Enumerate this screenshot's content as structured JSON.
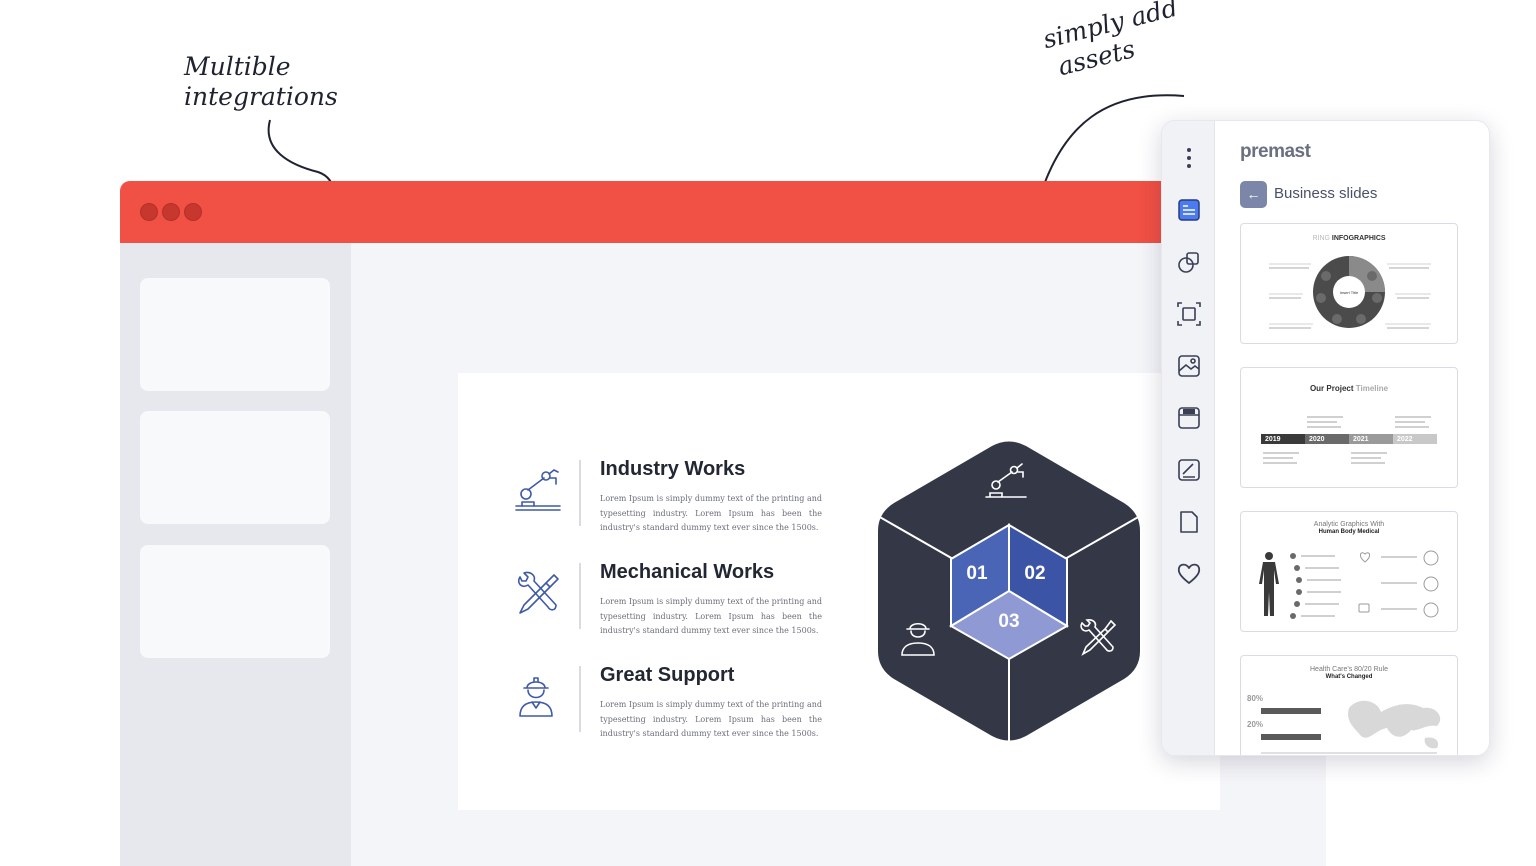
{
  "annotations": {
    "left_line1": "Multible",
    "left_line2": "integrations",
    "right_line1": "simply add",
    "right_line2": "assets"
  },
  "slide": {
    "features": [
      {
        "title": "Industry Works",
        "text": "Lorem Ipsum is simply dummy text of the printing and typesetting industry.  Lorem Ipsum has been the industry's standard dummy text ever since the 1500s.",
        "icon": "robot-arm-icon"
      },
      {
        "title": "Mechanical Works",
        "text": "Lorem Ipsum is simply dummy text of the printing and typesetting industry.  Lorem Ipsum has been the industry's standard dummy text ever since the 1500s.",
        "icon": "wrench-screwdriver-icon"
      },
      {
        "title": "Great Support",
        "text": "Lorem Ipsum is simply dummy text of the printing and typesetting industry.  Lorem Ipsum has been the industry's standard dummy text ever since the 1500s.",
        "icon": "worker-icon"
      }
    ],
    "cube_labels": [
      "01",
      "02",
      "03"
    ]
  },
  "panel": {
    "brand": "premast",
    "back_label": "←",
    "title": "Business slides",
    "rail_icons": [
      "more-vertical-icon",
      "slides-icon",
      "shapes-icon",
      "frame-icon",
      "image-icon",
      "gif-icon",
      "chart-icon",
      "document-icon",
      "heart-icon"
    ],
    "thumbnails": {
      "t1_prefix": "RING",
      "t1_title": "INFOGRAPHICS",
      "t1_center": "Insert Title",
      "t2_title_bold": "Our Project",
      "t2_title_light": "Timeline",
      "t2_years": [
        "2019",
        "2020",
        "2021",
        "2022"
      ],
      "t3_title_line1": "Analytic Graphics With",
      "t3_title_line2": "Human Body Medical",
      "t4_title_line1": "Health Care's 80/20 Rule",
      "t4_title_line2": "What's Changed",
      "t4_pct1": "80%",
      "t4_pct2": "20%"
    }
  },
  "colors": {
    "titlebar": "#f15044",
    "cube_dark": "#343846",
    "blue_1": "#4a64b6",
    "blue_2": "#3b54a6",
    "blue_3": "#8f9ad4",
    "icon_blue": "#3e5aa8"
  }
}
